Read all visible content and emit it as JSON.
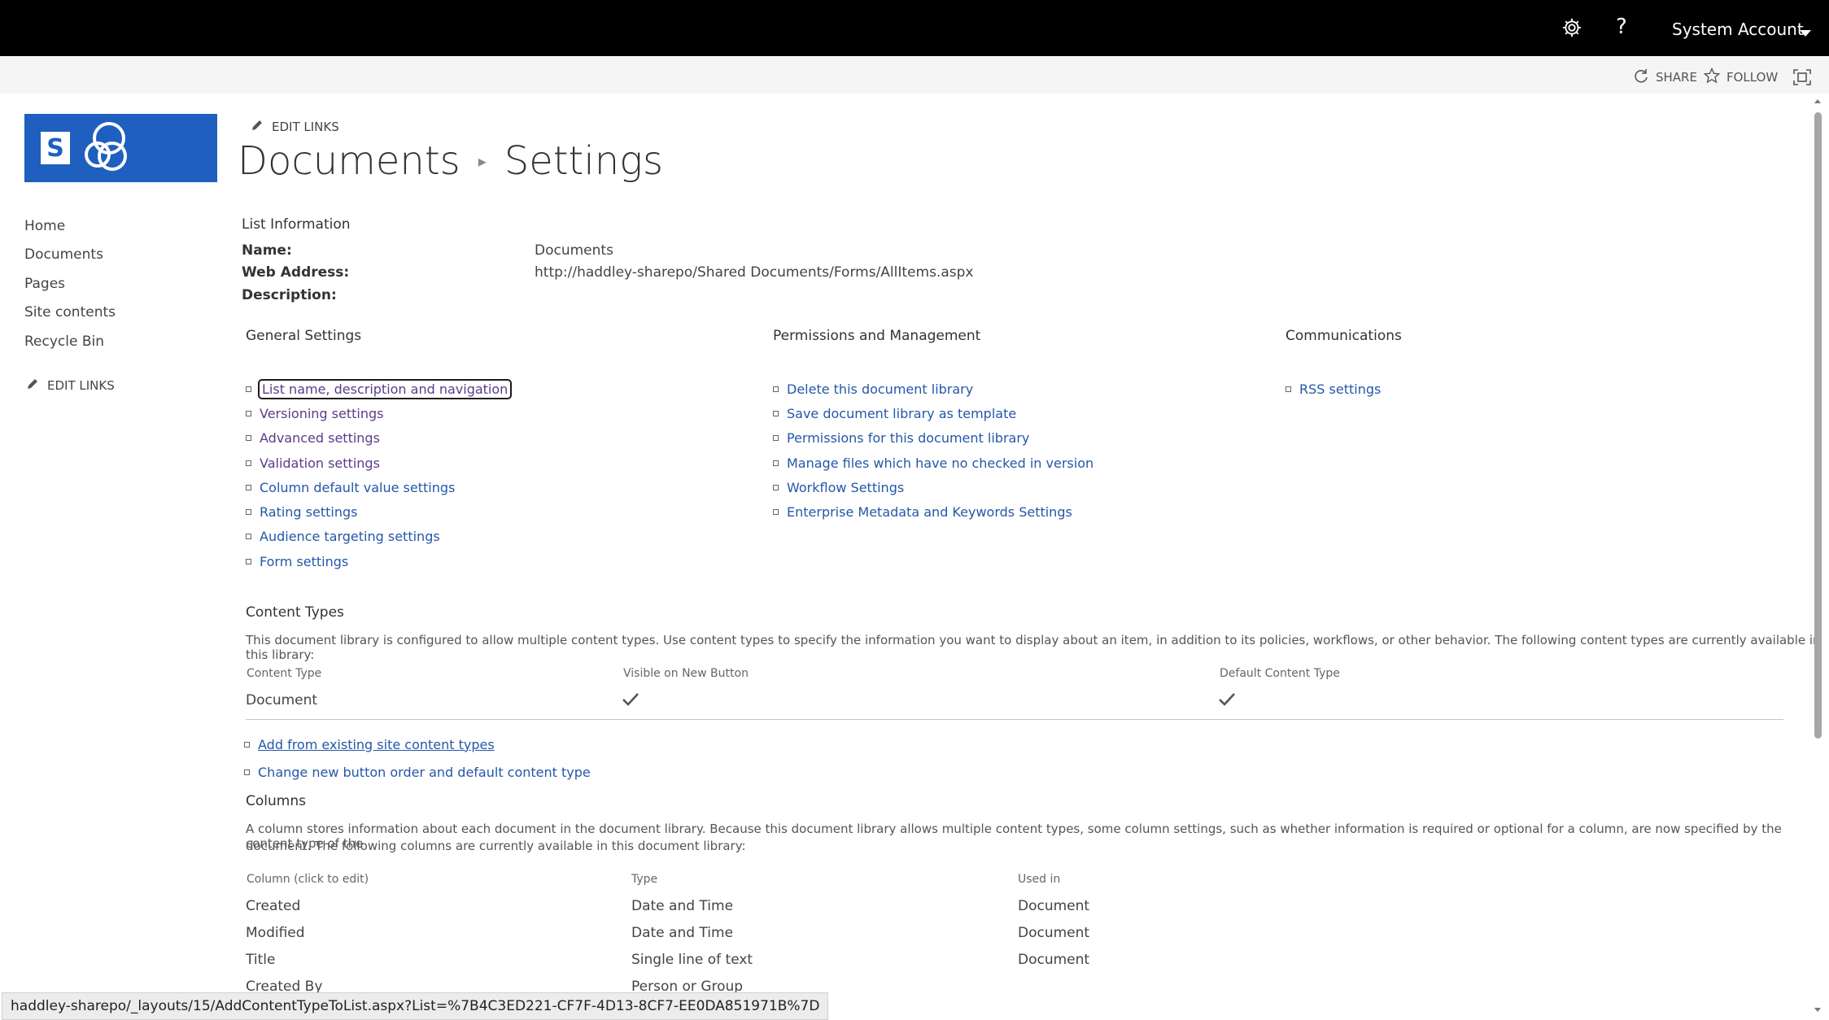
{
  "suitebar": {
    "account": "System Account"
  },
  "ribbon": {
    "share": "SHARE",
    "follow": "FOLLOW"
  },
  "nav": {
    "edit_links": "EDIT LINKS",
    "items": [
      "Home",
      "Documents",
      "Pages",
      "Site contents",
      "Recycle Bin"
    ]
  },
  "header": {
    "edit_links": "EDIT LINKS",
    "breadcrumb": [
      "Documents",
      "Settings"
    ]
  },
  "list_info": {
    "heading": "List Information",
    "name_label": "Name:",
    "name_value": "Documents",
    "web_label": "Web Address:",
    "web_value": "http://haddley-sharepo/Shared Documents/Forms/AllItems.aspx",
    "desc_label": "Description:"
  },
  "general": {
    "heading": "General Settings",
    "links": [
      "List name, description and navigation",
      "Versioning settings",
      "Advanced settings",
      "Validation settings",
      "Column default value settings",
      "Rating settings",
      "Audience targeting settings",
      "Form settings"
    ]
  },
  "permissions": {
    "heading": "Permissions and Management",
    "links": [
      "Delete this document library",
      "Save document library as template",
      "Permissions for this document library",
      "Manage files which have no checked in version",
      "Workflow Settings",
      "Enterprise Metadata and Keywords Settings"
    ]
  },
  "communications": {
    "heading": "Communications",
    "links": [
      "RSS settings"
    ]
  },
  "content_types": {
    "heading": "Content Types",
    "description": "This document library is configured to allow multiple content types. Use content types to specify the information you want to display about an item, in addition to its policies, workflows, or other behavior. The following content types are currently available in this library:",
    "col_type": "Content Type",
    "col_visible": "Visible on New Button",
    "col_default": "Default Content Type",
    "rows": [
      {
        "name": "Document",
        "visible": true,
        "default": true
      }
    ],
    "add_link": "Add from existing site content types",
    "order_link": "Change new button order and default content type"
  },
  "columns": {
    "heading": "Columns",
    "description_1": "A column stores information about each document in the document library. Because this document library allows multiple content types, some column settings, such as whether information is required or optional for a column, are now specified by the content type of the",
    "description_2": "document. The following columns are currently available in this document library:",
    "col_name": "Column (click to edit)",
    "col_type": "Type",
    "col_used": "Used in",
    "rows": [
      {
        "name": "Created",
        "type": "Date and Time",
        "used": "Document"
      },
      {
        "name": "Modified",
        "type": "Date and Time",
        "used": "Document"
      },
      {
        "name": "Title",
        "type": "Single line of text",
        "used": "Document"
      },
      {
        "name": "Created By",
        "type": "Person or Group",
        "used": ""
      }
    ]
  },
  "status_url": "haddley-sharepo/_layouts/15/AddContentTypeToList.aspx?List=%7B4C3ED221-CF7F-4D13-8CF7-EE0DA851971B%7D",
  "icons": {
    "settings": "gear-icon",
    "help": "question-icon",
    "share": "share-icon",
    "follow": "star-icon",
    "focus": "focus-mode-icon",
    "edit": "pencil-icon",
    "check": "checkmark-icon"
  },
  "colors": {
    "suitebar": "#000000",
    "brand": "#1f5fbf",
    "link": "#2457a8",
    "visited": "#5b3a8a"
  }
}
